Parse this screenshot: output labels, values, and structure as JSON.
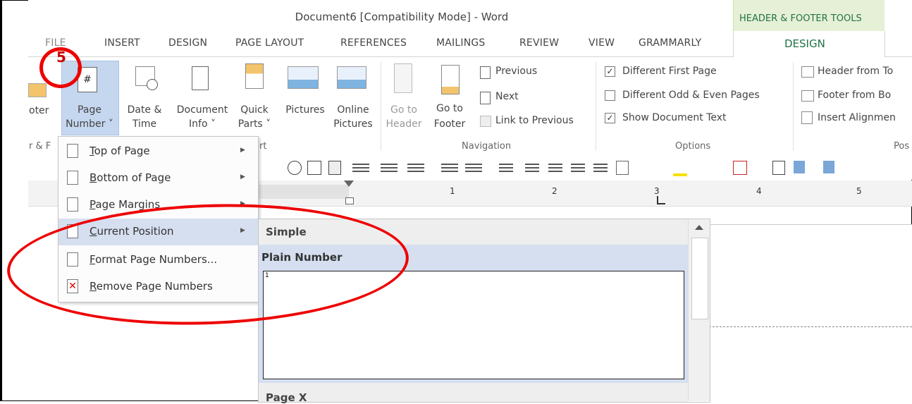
{
  "window": {
    "title": "Document6 [Compatibility Mode] - Word",
    "contextual_tab_group": "HEADER & FOOTER TOOLS"
  },
  "tabs": {
    "hidden_partial": "FILE",
    "insert": "INSERT",
    "design": "DESIGN",
    "page_layout": "PAGE LAYOUT",
    "references": "REFERENCES",
    "mailings": "MAILINGS",
    "review": "REVIEW",
    "view": "VIEW",
    "grammarly": "GRAMMARLY",
    "design_active": "DESIGN"
  },
  "ribbon": {
    "footer_partial": {
      "line1": "oter",
      "line2": "˅"
    },
    "page_number": {
      "line1": "Page",
      "line2": "Number ˅"
    },
    "date_time": {
      "line1": "Date &",
      "line2": "Time"
    },
    "document_info": {
      "line1": "Document",
      "line2": "Info ˅"
    },
    "quick_parts": {
      "line1": "Quick",
      "line2": "Parts ˅"
    },
    "pictures": {
      "line1": "Pictures"
    },
    "online_pictures": {
      "line1": "Online",
      "line2": "Pictures"
    },
    "go_to_header": {
      "line1": "Go to",
      "line2": "Header"
    },
    "go_to_footer": {
      "line1": "Go to",
      "line2": "Footer"
    },
    "previous": "Previous",
    "next": "Next",
    "link_to_previous": "Link to Previous",
    "options": {
      "different_first_page": "Different First Page",
      "different_odd_even": "Different Odd & Even Pages",
      "show_document_text": "Show Document Text"
    },
    "position": {
      "header_from_top": "Header from To",
      "footer_from_bottom": "Footer from Bo",
      "insert_alignment": "Insert Alignmen"
    },
    "groups": {
      "header_footer_partial": "r & F",
      "insert_partial": "rt",
      "navigation": "Navigation",
      "options": "Options",
      "position_partial": "Pos"
    }
  },
  "ruler": {
    "marks": [
      "1",
      "2",
      "3",
      "4",
      "5"
    ]
  },
  "dropdown": {
    "items": [
      {
        "label": "Top of Page",
        "access": "T",
        "rest": "op of Page",
        "submenu": true
      },
      {
        "label": "Bottom of Page",
        "access": "B",
        "rest": "ottom of Page",
        "submenu": true
      },
      {
        "label": "Page Margins",
        "access": "P",
        "rest": "age Margins",
        "submenu": true
      },
      {
        "label": "Current Position",
        "access": "C",
        "rest": "urrent Position",
        "submenu": true
      },
      {
        "label": "Format Page Numbers...",
        "access": "F",
        "rest": "ormat Page Numbers...",
        "submenu": false
      },
      {
        "label": "Remove Page Numbers",
        "access": "R",
        "rest": "emove Page Numbers",
        "submenu": false
      }
    ]
  },
  "gallery": {
    "section_simple": "Simple",
    "item_plain_number": "Plain Number",
    "preview_number": "1",
    "section_page_x": "Page X"
  },
  "annotation": {
    "step_number": "5"
  },
  "colors": {
    "accent": "#217346",
    "highlight": "#d5dff0",
    "annotation_red": "#e00000"
  }
}
